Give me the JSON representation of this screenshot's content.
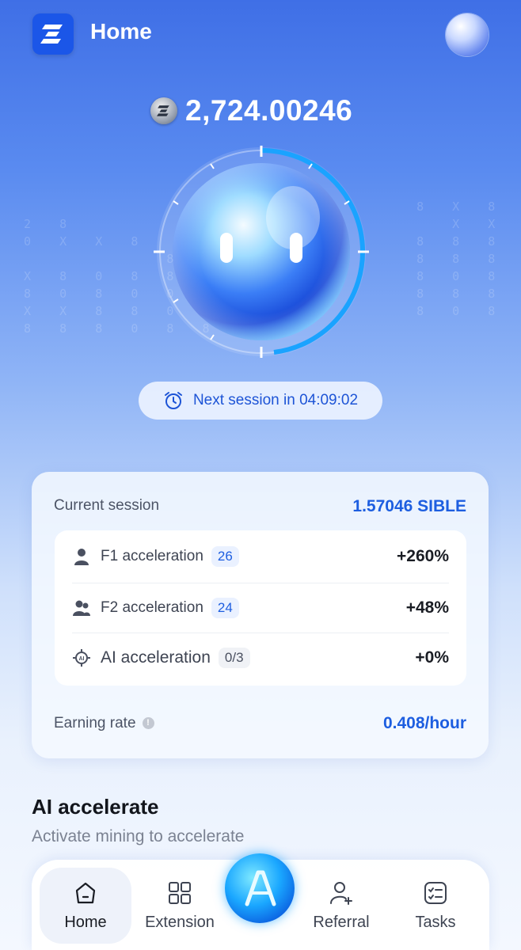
{
  "header": {
    "title": "Home"
  },
  "balance": {
    "value": "2,724.00246"
  },
  "session": {
    "next_session": "Next session in 04:09:02"
  },
  "card": {
    "current_session_label": "Current session",
    "current_session_value": "1.57046 SIBLE",
    "accelerations": [
      {
        "label": "F1 acceleration",
        "count": "26",
        "percent": "+260%",
        "icon": "person-icon"
      },
      {
        "label": "F2 acceleration",
        "count": "24",
        "percent": "+48%",
        "icon": "people-icon"
      },
      {
        "label": "AI acceleration",
        "count": "0/3",
        "percent": "+0%",
        "icon": "ai-chip-icon"
      }
    ],
    "earning_rate_label": "Earning rate",
    "earning_rate_value": "0.408/hour"
  },
  "ai_section": {
    "title": "AI accelerate",
    "subtitle": "Activate mining to accelerate"
  },
  "nav": {
    "items": [
      {
        "label": "Home",
        "icon": "home-icon"
      },
      {
        "label": "Extension",
        "icon": "grid-icon"
      },
      {
        "label": "Referral",
        "icon": "add-user-icon"
      },
      {
        "label": "Tasks",
        "icon": "checklist-icon"
      }
    ],
    "center_icon": "ai-logo-icon"
  },
  "colors": {
    "accent": "#1d5ee0",
    "brand": "#1b56e8"
  }
}
